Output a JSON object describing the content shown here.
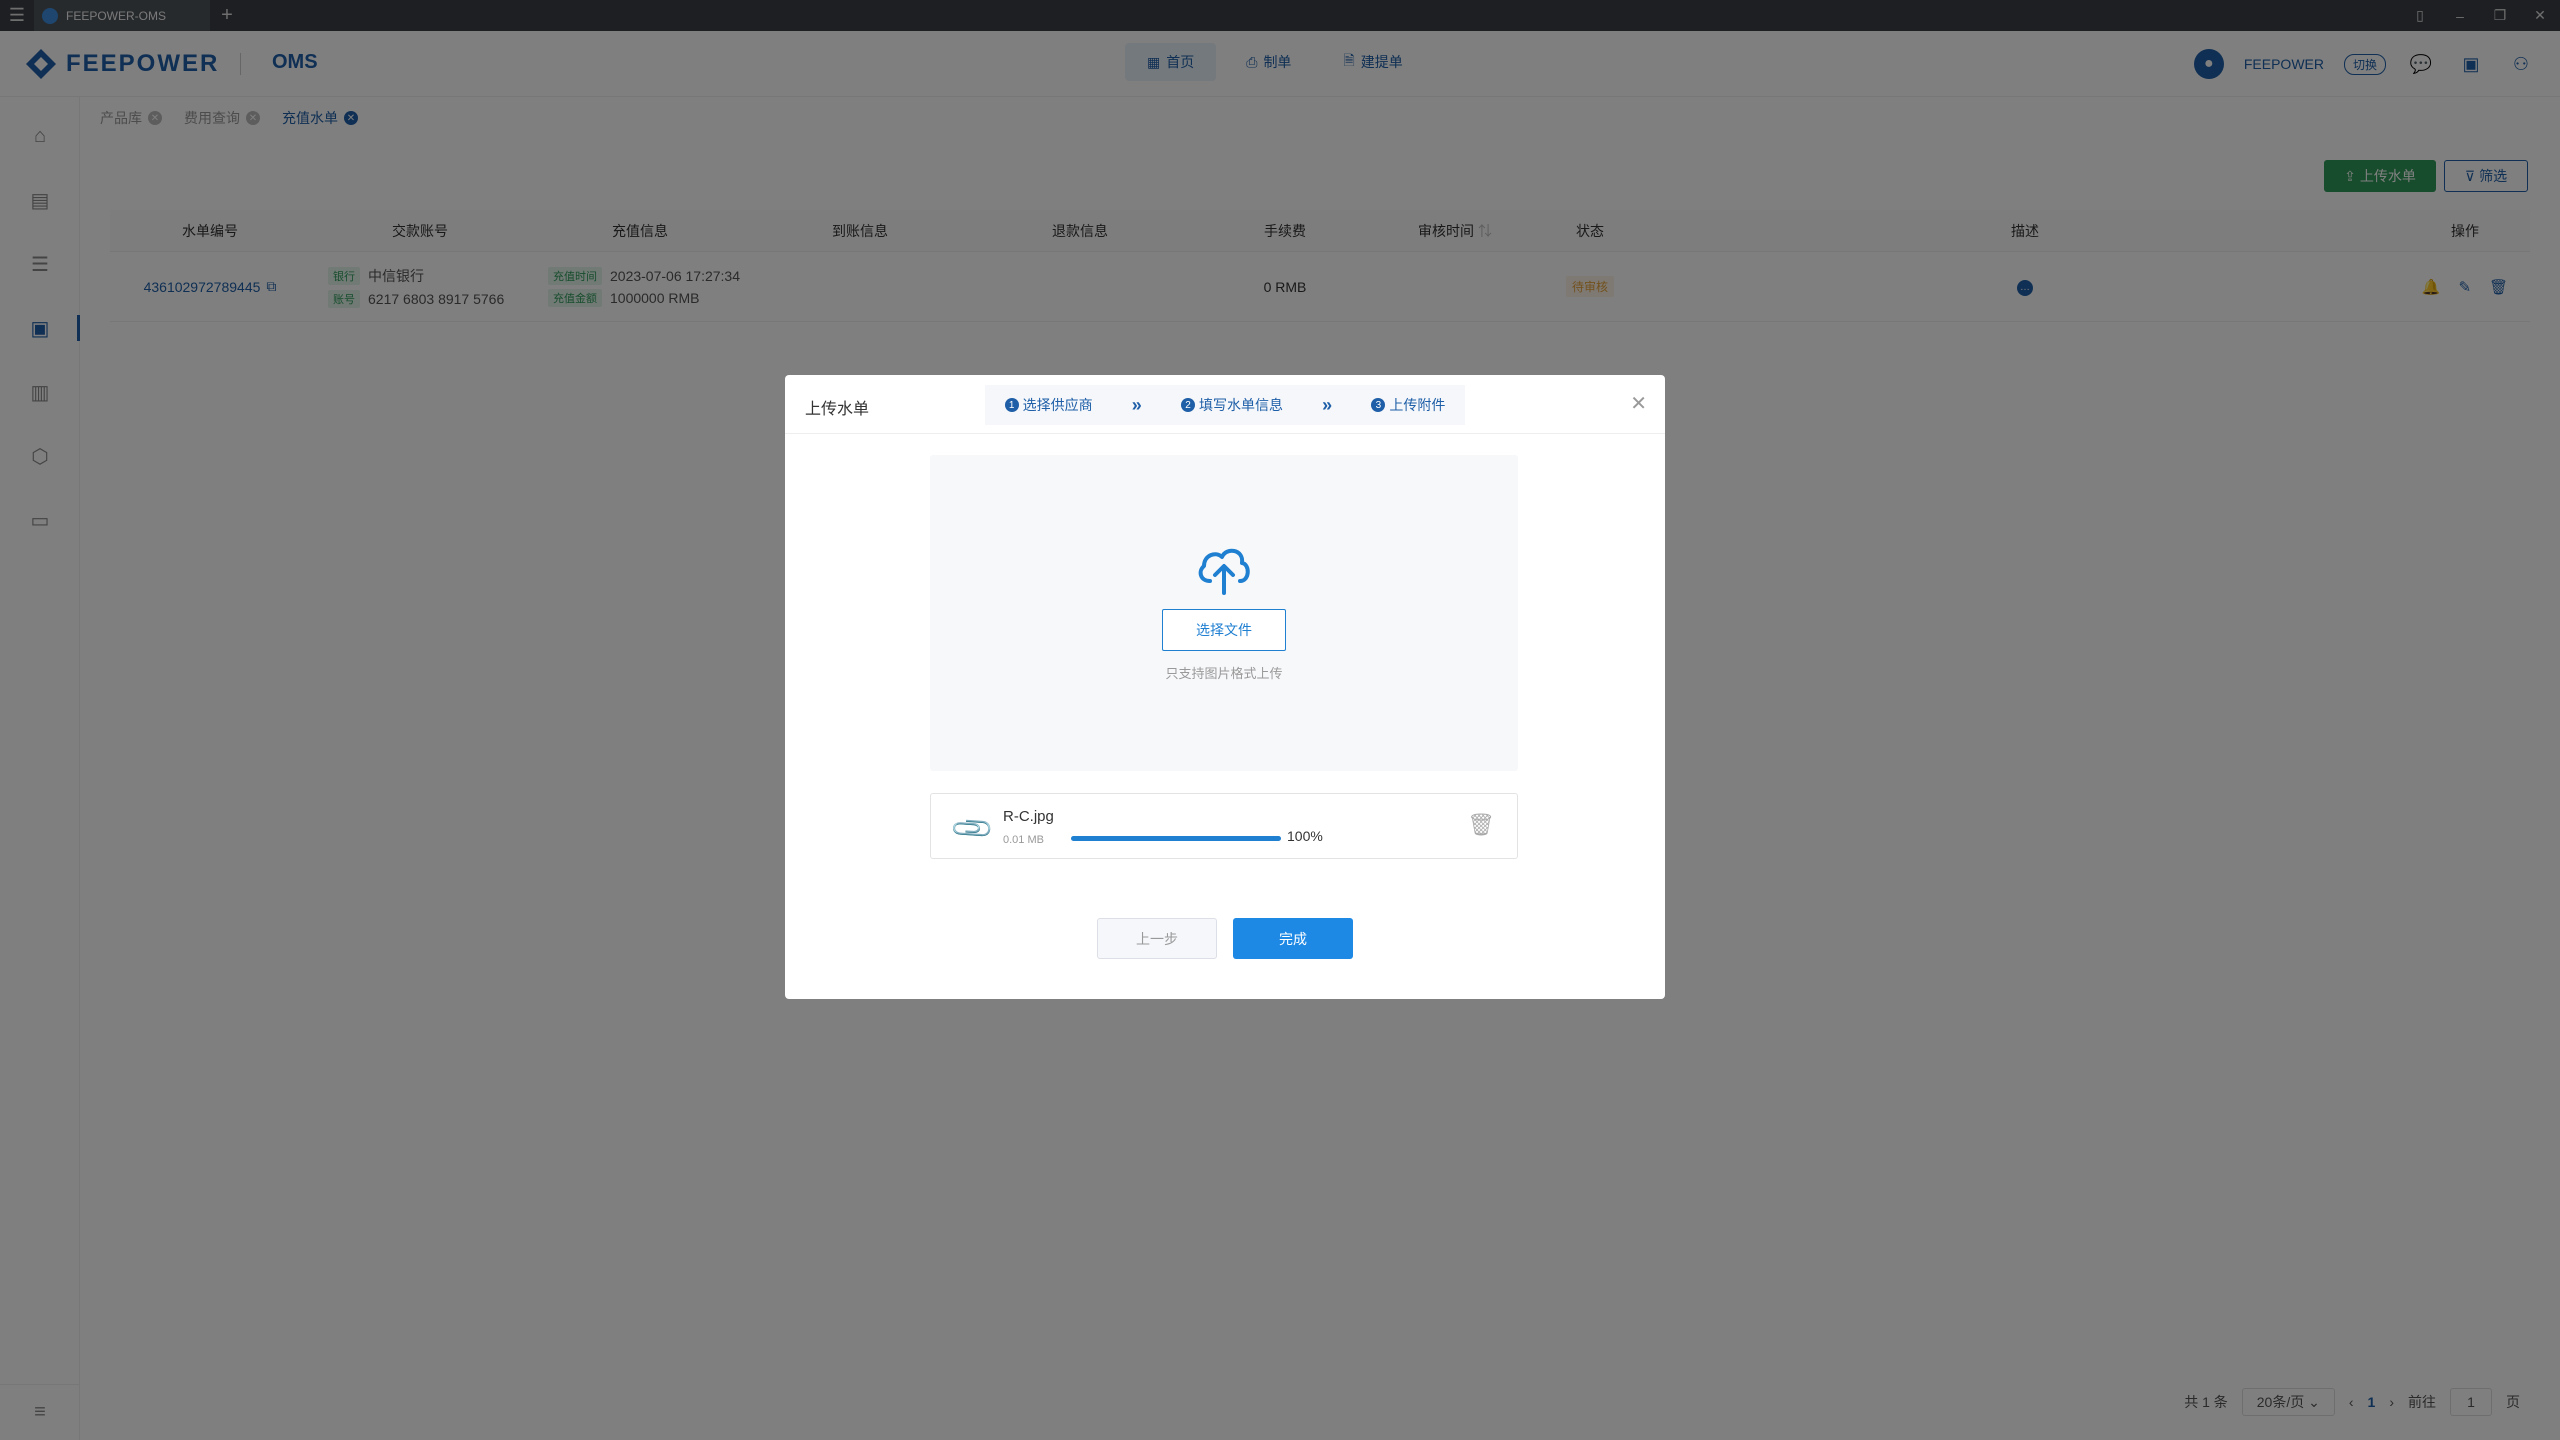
{
  "window": {
    "tab_title": "FEEPOWER-OMS",
    "plus": "+",
    "menu_icon": "hamburger-icon"
  },
  "header": {
    "brand": "FEEPOWER",
    "product": "OMS",
    "nav": [
      {
        "label": "首页",
        "icon": "grid-icon"
      },
      {
        "label": "制单",
        "icon": "user-doc-icon"
      },
      {
        "label": "建提单",
        "icon": "doc-add-icon"
      }
    ],
    "user": "FEEPOWER",
    "switch_label": "切换"
  },
  "breadcrumbs": [
    {
      "label": "产品库"
    },
    {
      "label": "费用查询"
    },
    {
      "label": "充值水单"
    }
  ],
  "toolbar": {
    "upload_label": "上传水单",
    "filter_label": "筛选"
  },
  "table": {
    "headers": [
      "水单编号",
      "交款账号",
      "充值信息",
      "到账信息",
      "退款信息",
      "手续费",
      "审核时间",
      "状态",
      "描述",
      "操作"
    ],
    "rows": [
      {
        "id": "436102972789445",
        "bank_tag": "银行",
        "bank": "中信银行",
        "account_tag": "账号",
        "account": "6217 6803 8917 5766",
        "time_tag": "充值时间",
        "time": "2023-07-06 17:27:34",
        "amount_tag": "充值金额",
        "amount": "1000000 RMB",
        "fee": "0 RMB",
        "status": "待审核"
      }
    ]
  },
  "pager": {
    "total": "共 1 条",
    "page_size": "20条/页",
    "page": "1",
    "goto_label": "前往",
    "goto_value": "1",
    "page_unit": "页"
  },
  "modal": {
    "title": "上传水单",
    "steps": [
      {
        "n": "1",
        "label": "选择供应商"
      },
      {
        "n": "2",
        "label": "填写水单信息"
      },
      {
        "n": "3",
        "label": "上传附件"
      }
    ],
    "choose_label": "选择文件",
    "hint": "只支持图片格式上传",
    "file": {
      "name": "R-C.jpg",
      "size": "0.01 MB",
      "progress": 100,
      "progress_label": "100%"
    },
    "prev_label": "上一步",
    "done_label": "完成",
    "accent": "#1e88e5"
  }
}
